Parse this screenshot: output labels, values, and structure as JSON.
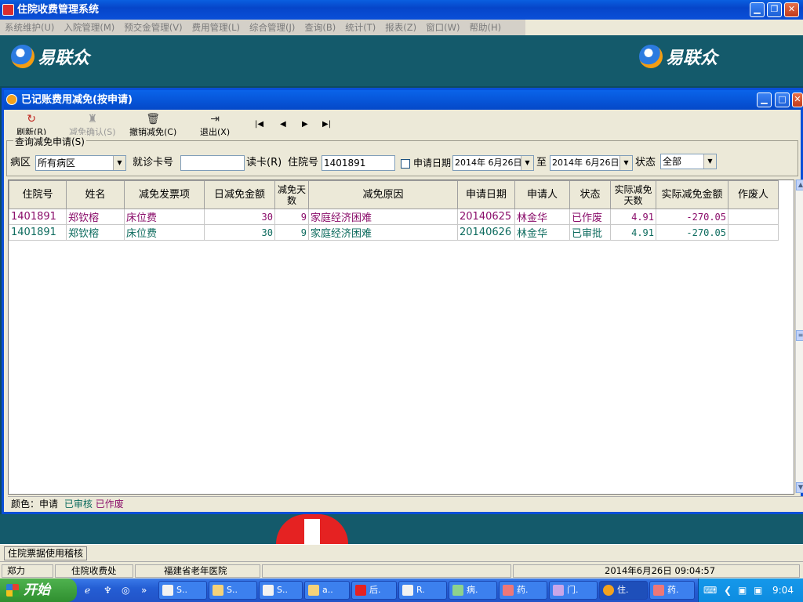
{
  "app": {
    "title": "住院收费管理系统"
  },
  "menu": [
    "系统维护(U)",
    "入院管理(M)",
    "预交金管理(V)",
    "费用管理(L)",
    "综合管理(J)",
    "查询(B)",
    "统计(T)",
    "报表(Z)",
    "窗口(W)",
    "帮助(H)"
  ],
  "banner": {
    "logo_text": "易联众"
  },
  "window": {
    "title": "已记账费用减免(按申请)"
  },
  "toolbar": {
    "refresh": "刷新(R)",
    "confirm": "减免确认(S)",
    "cancel_reduce": "撤销减免(C)",
    "exit": "退出(X)"
  },
  "query": {
    "legend": "查询减免申请(S)",
    "ward_label": "病区",
    "ward_value": "所有病区",
    "card_label": "就诊卡号",
    "card_value": "",
    "read_card": "读卡(R)",
    "inpatient_label": "住院号",
    "inpatient_value": "1401891",
    "apply_date_label": "申请日期",
    "date_from": "2014年 6月26日",
    "to_label": "至",
    "date_to": "2014年 6月26日",
    "status_label": "状态",
    "status_value": "全部"
  },
  "grid": {
    "columns": [
      "住院号",
      "姓名",
      "减免发票项",
      "日减免金额",
      "减免天数",
      "减免原因",
      "申请日期",
      "申请人",
      "状态",
      "实际减免天数",
      "实际减免金额",
      "作废人"
    ],
    "rows": [
      [
        "1401891",
        "郑钦榕",
        "床位费",
        "30",
        "9",
        "家庭经济困难",
        "20140625",
        "林金华",
        "已作废",
        "4.91",
        "-270.05",
        ""
      ],
      [
        "1401891",
        "郑钦榕",
        "床位费",
        "30",
        "9",
        "家庭经济困难",
        "20140626",
        "林金华",
        "已审批",
        "4.91",
        "-270.05",
        ""
      ]
    ]
  },
  "legend_bar": {
    "label": "颜色：申请",
    "reviewed": "已审核",
    "voided": "已作废"
  },
  "colors": {
    "voided": "#8a0d6a",
    "approved": "#0d6b5e",
    "title_bar": "#0a4fd8"
  },
  "status_tab": "住院票据使用稽核",
  "statusbar": {
    "user": "郑力",
    "dept": "住院收费处",
    "hospital": "福建省老年医院",
    "datetime": "2014年6月26日 09:04:57"
  },
  "taskbar": {
    "start": "开始",
    "tasks": [
      "S..",
      "S..",
      "S..",
      "a..",
      "后.",
      "R.",
      "病.",
      "药.",
      "门.",
      "住.",
      "药."
    ],
    "clock": "9:04"
  }
}
